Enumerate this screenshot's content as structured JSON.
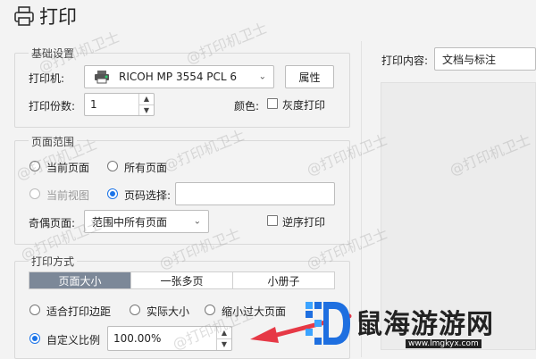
{
  "window": {
    "title": "打印"
  },
  "basic": {
    "legend": "基础设置",
    "printer_label": "打印机:",
    "printer_value": "RICOH MP 3554 PCL 6",
    "properties_button": "属性",
    "copies_label": "打印份数:",
    "copies_value": "1",
    "color_label": "颜色:",
    "grayscale_label": "灰度打印"
  },
  "range": {
    "legend": "页面范围",
    "current_page": "当前页面",
    "all_pages": "所有页面",
    "current_view": "当前视图",
    "page_select": "页码选择:",
    "page_select_value": "",
    "odd_even_label": "奇偶页面:",
    "odd_even_value": "范围中所有页面",
    "reverse_label": "逆序打印"
  },
  "mode": {
    "legend": "打印方式",
    "tabs": [
      "页面大小",
      "一张多页",
      "小册子"
    ],
    "fit_margins": "适合打印边距",
    "actual_size": "实际大小",
    "shrink_large": "缩小过大页面",
    "custom_scale": "自定义比例",
    "scale_value": "100.00%"
  },
  "preview": {
    "content_label": "打印内容:",
    "content_value": "文档与标注"
  },
  "watermark": {
    "text": "@打印机卫士"
  },
  "logo": {
    "text": "鼠海游游网",
    "url": "www.lmgkyx.com"
  },
  "colors": {
    "accent": "#1a73e8",
    "tab_active": "#7c8898",
    "arrow": "#e63946"
  }
}
